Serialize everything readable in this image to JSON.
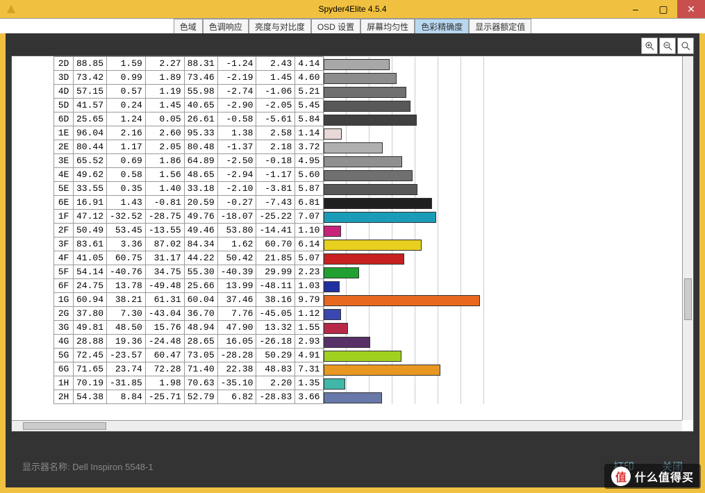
{
  "window": {
    "title": "Spyder4Elite 4.5.4",
    "controls": {
      "minimize": "–",
      "maximize": "▢",
      "close": "✕"
    }
  },
  "tabs": [
    {
      "label": "色域"
    },
    {
      "label": "色调响应"
    },
    {
      "label": "亮度与对比度"
    },
    {
      "label": "OSD 设置"
    },
    {
      "label": "屏幕均匀性"
    },
    {
      "label": "色彩精确度",
      "active": true
    },
    {
      "label": "显示器额定值"
    }
  ],
  "toolbar": {
    "zoom_in": "+",
    "zoom_out": "−",
    "zoom_reset": "⊡"
  },
  "chart_data": {
    "type": "bar",
    "xlabel": "",
    "ylabel": "",
    "xlim": [
      0,
      10
    ],
    "rows": [
      {
        "label": "2D",
        "v1": 88.85,
        "v2": 1.59,
        "v3": 2.27,
        "v4": 88.31,
        "v5": -1.24,
        "v6": 2.43,
        "value": 4.14,
        "color": "#a8a8a8"
      },
      {
        "label": "3D",
        "v1": 73.42,
        "v2": 0.99,
        "v3": 1.89,
        "v4": 73.46,
        "v5": -2.19,
        "v6": 1.45,
        "value": 4.6,
        "color": "#8c8c8c"
      },
      {
        "label": "4D",
        "v1": 57.15,
        "v2": 0.57,
        "v3": 1.19,
        "v4": 55.98,
        "v5": -2.74,
        "v6": -1.06,
        "value": 5.21,
        "color": "#707070"
      },
      {
        "label": "5D",
        "v1": 41.57,
        "v2": 0.24,
        "v3": 1.45,
        "v4": 40.65,
        "v5": -2.9,
        "v6": -2.05,
        "value": 5.45,
        "color": "#585858"
      },
      {
        "label": "6D",
        "v1": 25.65,
        "v2": 1.24,
        "v3": 0.05,
        "v4": 26.61,
        "v5": -0.58,
        "v6": -5.61,
        "value": 5.84,
        "color": "#404040"
      },
      {
        "label": "1E",
        "v1": 96.04,
        "v2": 2.16,
        "v3": 2.6,
        "v4": 95.33,
        "v5": 1.38,
        "v6": 2.58,
        "value": 1.14,
        "color": "#e8d8d8"
      },
      {
        "label": "2E",
        "v1": 80.44,
        "v2": 1.17,
        "v3": 2.05,
        "v4": 80.48,
        "v5": -1.37,
        "v6": 2.18,
        "value": 3.72,
        "color": "#b0b0b0"
      },
      {
        "label": "3E",
        "v1": 65.52,
        "v2": 0.69,
        "v3": 1.86,
        "v4": 64.89,
        "v5": -2.5,
        "v6": -0.18,
        "value": 4.95,
        "color": "#909090"
      },
      {
        "label": "4E",
        "v1": 49.62,
        "v2": 0.58,
        "v3": 1.56,
        "v4": 48.65,
        "v5": -2.94,
        "v6": -1.17,
        "value": 5.6,
        "color": "#707070"
      },
      {
        "label": "5E",
        "v1": 33.55,
        "v2": 0.35,
        "v3": 1.4,
        "v4": 33.18,
        "v5": -2.1,
        "v6": -3.81,
        "value": 5.87,
        "color": "#585858"
      },
      {
        "label": "6E",
        "v1": 16.91,
        "v2": 1.43,
        "v3": -0.81,
        "v4": 20.59,
        "v5": -0.27,
        "v6": -7.43,
        "value": 6.81,
        "color": "#202020"
      },
      {
        "label": "1F",
        "v1": 47.12,
        "v2": -32.52,
        "v3": -28.75,
        "v4": 49.76,
        "v5": -18.07,
        "v6": -25.22,
        "value": 7.07,
        "color": "#1a9cb8"
      },
      {
        "label": "2F",
        "v1": 50.49,
        "v2": 53.45,
        "v3": -13.55,
        "v4": 49.46,
        "v5": 53.8,
        "v6": -14.41,
        "value": 1.1,
        "color": "#c8227a"
      },
      {
        "label": "3F",
        "v1": 83.61,
        "v2": 3.36,
        "v3": 87.02,
        "v4": 84.34,
        "v5": 1.62,
        "v6": 60.7,
        "value": 6.14,
        "color": "#e8d020"
      },
      {
        "label": "4F",
        "v1": 41.05,
        "v2": 60.75,
        "v3": 31.17,
        "v4": 44.22,
        "v5": 50.42,
        "v6": 21.85,
        "value": 5.07,
        "color": "#c82020"
      },
      {
        "label": "5F",
        "v1": 54.14,
        "v2": -40.76,
        "v3": 34.75,
        "v4": 55.3,
        "v5": -40.39,
        "v6": 29.99,
        "value": 2.23,
        "color": "#20a030"
      },
      {
        "label": "6F",
        "v1": 24.75,
        "v2": 13.78,
        "v3": -49.48,
        "v4": 25.66,
        "v5": 13.99,
        "v6": -48.11,
        "value": 1.03,
        "color": "#2030a0"
      },
      {
        "label": "1G",
        "v1": 60.94,
        "v2": 38.21,
        "v3": 61.31,
        "v4": 60.04,
        "v5": 37.46,
        "v6": 38.16,
        "value": 9.79,
        "color": "#e86820"
      },
      {
        "label": "2G",
        "v1": 37.8,
        "v2": 7.3,
        "v3": -43.04,
        "v4": 36.7,
        "v5": 7.76,
        "v6": -45.05,
        "value": 1.12,
        "color": "#3848b0"
      },
      {
        "label": "3G",
        "v1": 49.81,
        "v2": 48.5,
        "v3": 15.76,
        "v4": 48.94,
        "v5": 47.9,
        "v6": 13.32,
        "value": 1.55,
        "color": "#b82848"
      },
      {
        "label": "4G",
        "v1": 28.88,
        "v2": 19.36,
        "v3": -24.48,
        "v4": 28.65,
        "v5": 16.05,
        "v6": -26.18,
        "value": 2.93,
        "color": "#583068"
      },
      {
        "label": "5G",
        "v1": 72.45,
        "v2": -23.57,
        "v3": 60.47,
        "v4": 73.05,
        "v5": -28.28,
        "v6": 50.29,
        "value": 4.91,
        "color": "#a0d020"
      },
      {
        "label": "6G",
        "v1": 71.65,
        "v2": 23.74,
        "v3": 72.28,
        "v4": 71.4,
        "v5": 22.38,
        "v6": 48.83,
        "value": 7.31,
        "color": "#e89820"
      },
      {
        "label": "1H",
        "v1": 70.19,
        "v2": -31.85,
        "v3": 1.98,
        "v4": 70.63,
        "v5": -35.1,
        "v6": 2.2,
        "value": 1.35,
        "color": "#40b8a8"
      },
      {
        "label": "2H",
        "v1": 54.38,
        "v2": 8.84,
        "v3": -25.71,
        "v4": 52.79,
        "v5": 6.82,
        "v6": -28.83,
        "value": 3.66,
        "color": "#6878a8"
      }
    ]
  },
  "footer": {
    "monitor_label": "显示器名称:",
    "monitor_name": "Dell Inspiron 5548-1",
    "print": "打印",
    "close": "关闭"
  },
  "watermark": {
    "badge": "值",
    "text": "什么值得买"
  }
}
